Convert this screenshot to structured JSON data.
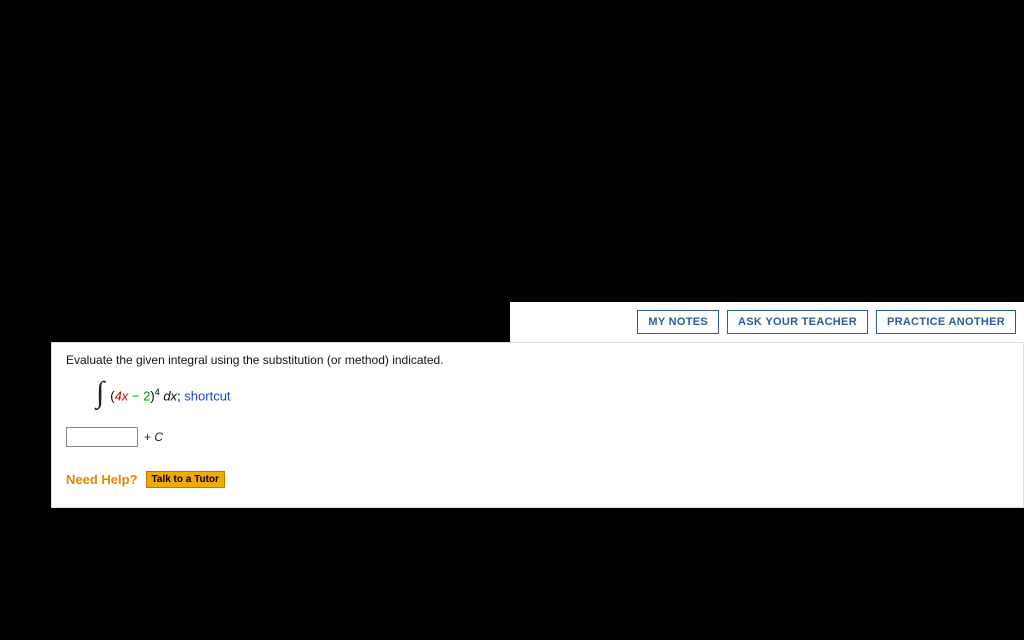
{
  "toolbar": {
    "my_notes": "MY NOTES",
    "ask_teacher": "ASK YOUR TEACHER",
    "practice_another": "PRACTICE ANOTHER"
  },
  "question": {
    "prompt": "Evaluate the given integral using the substitution (or method) indicated.",
    "integral": {
      "open_paren": "(",
      "term1": "4x",
      "minus": " − ",
      "term2": "2",
      "close_paren": ")",
      "exponent": "4",
      "dx": " dx",
      "semicolon": "; ",
      "method": "shortcut"
    },
    "answer": {
      "value": "",
      "suffix_plus": "+ ",
      "suffix_c": "C"
    }
  },
  "help": {
    "label": "Need Help?",
    "tutor_button": "Talk to a Tutor"
  }
}
